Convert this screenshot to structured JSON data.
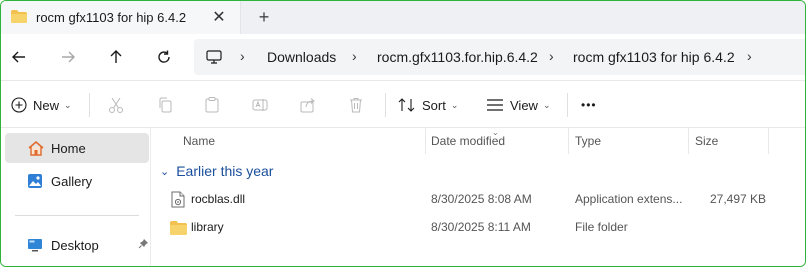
{
  "tab": {
    "title": "rocm gfx1103 for hip 6.4.2",
    "close": "✕",
    "new": "+"
  },
  "nav": {
    "back": "←",
    "forward": "→",
    "up": "↑",
    "refresh": "⟳"
  },
  "breadcrumb": {
    "items": [
      "Downloads",
      "rocm.gfx1103.for.hip.6.4.2",
      "rocm gfx1103 for hip 6.4.2"
    ],
    "sep": "›"
  },
  "toolbar": {
    "new_label": "New",
    "sort_label": "Sort",
    "view_label": "View",
    "more_label": "•••",
    "chevron": "⌄"
  },
  "sidebar": {
    "items": [
      {
        "label": "Home",
        "icon": "home-icon",
        "selected": true
      },
      {
        "label": "Gallery",
        "icon": "gallery-icon",
        "selected": false
      },
      {
        "label": "Desktop",
        "icon": "desktop-icon",
        "pinned": true
      }
    ],
    "pin": "📌"
  },
  "columns": {
    "name": "Name",
    "date": "Date modified",
    "type": "Type",
    "size": "Size"
  },
  "group": {
    "label": "Earlier this year",
    "chevron": "⌄"
  },
  "files": [
    {
      "name": "rocblas.dll",
      "date": "8/30/2025 8:08 AM",
      "type": "Application extens...",
      "size": "27,497 KB",
      "icon": "dll-file-icon"
    },
    {
      "name": "library",
      "date": "8/30/2025 8:11 AM",
      "type": "File folder",
      "size": "",
      "icon": "folder-icon"
    }
  ],
  "colors": {
    "accent": "#1a4f9c",
    "folder": "#f2c14e",
    "frame": "#2fb33a"
  }
}
